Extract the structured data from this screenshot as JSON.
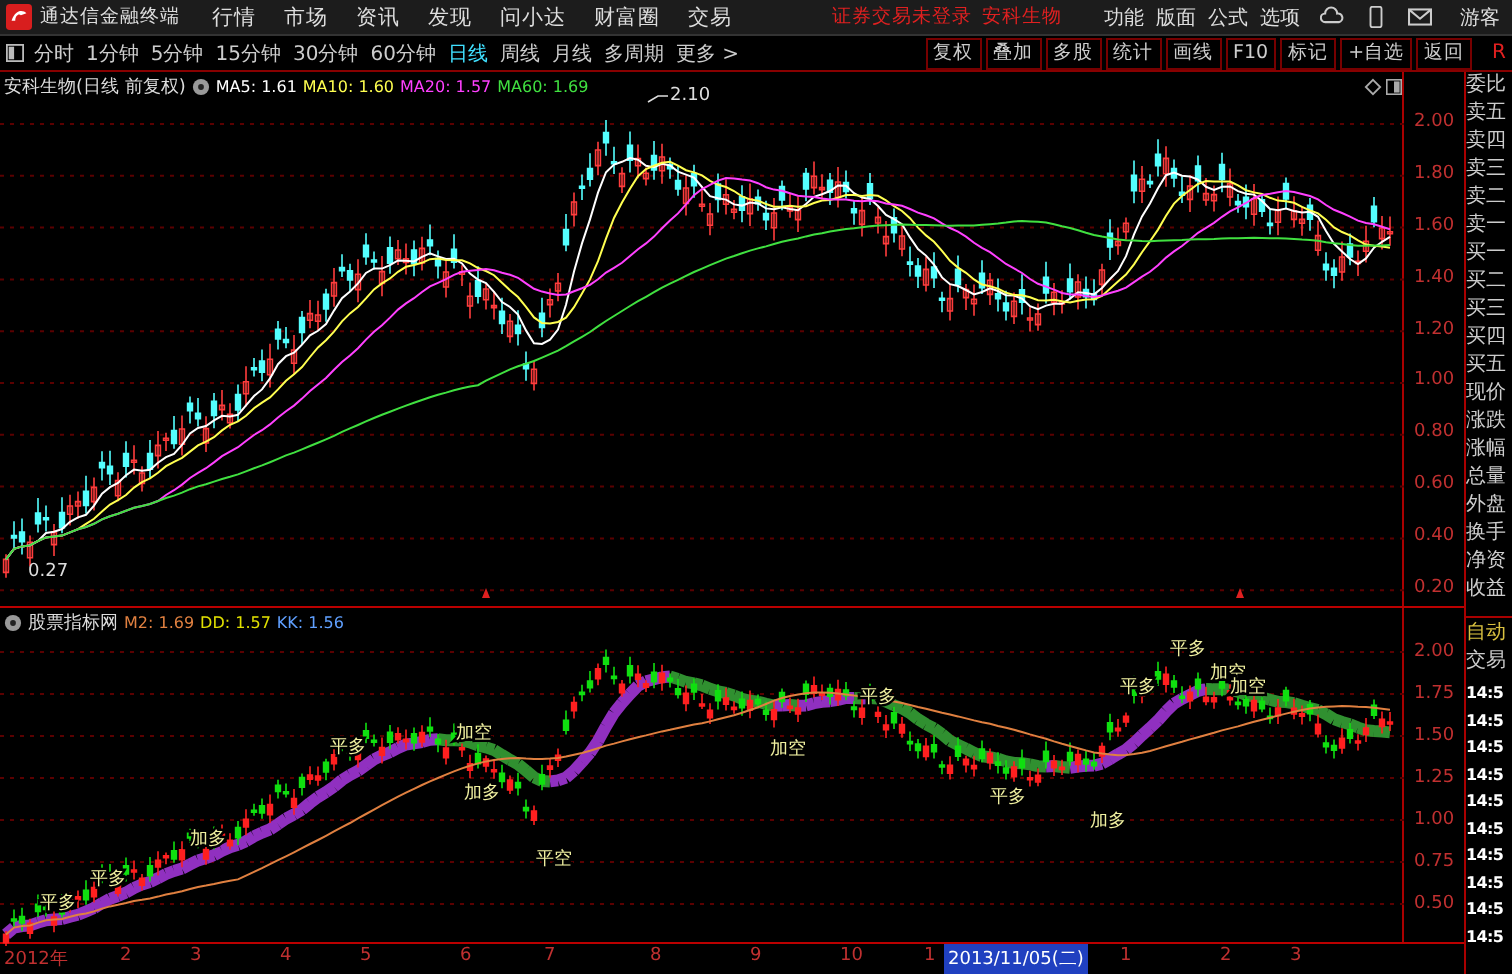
{
  "app": {
    "title": "通达信金融终端"
  },
  "menu": [
    "行情",
    "市场",
    "资讯",
    "发现",
    "问小达",
    "财富圈",
    "交易"
  ],
  "login_status": "证券交易未登录",
  "stock_link": "安科生物",
  "top_actions": [
    "功能",
    "版面",
    "公式",
    "选项"
  ],
  "user": "游客",
  "period_tabs": [
    {
      "label": "分时",
      "selected": false
    },
    {
      "label": "1分钟",
      "selected": false
    },
    {
      "label": "5分钟",
      "selected": false
    },
    {
      "label": "15分钟",
      "selected": false
    },
    {
      "label": "30分钟",
      "selected": false
    },
    {
      "label": "60分钟",
      "selected": false
    },
    {
      "label": "日线",
      "selected": true
    },
    {
      "label": "周线",
      "selected": false
    },
    {
      "label": "月线",
      "selected": false
    },
    {
      "label": "多周期",
      "selected": false
    },
    {
      "label": "更多 >",
      "selected": false
    }
  ],
  "tool_buttons": [
    "复权",
    "叠加",
    "多股",
    "统计",
    "画线",
    "F10",
    "标记",
    "+自选",
    "返回"
  ],
  "corner_label": "R",
  "upper_chart": {
    "title": "安科生物(日线 前复权)",
    "legend": [
      {
        "label": "MA5: 1.61",
        "color": "#ffffff"
      },
      {
        "label": "MA10: 1.60",
        "color": "#ffff50"
      },
      {
        "label": "MA20: 1.57",
        "color": "#ff40ff"
      },
      {
        "label": "MA60: 1.69",
        "color": "#40e040"
      }
    ],
    "high_mark": "2.10",
    "low_mark": "0.27",
    "y_labels": [
      "2.00",
      "1.80",
      "1.60",
      "1.40",
      "1.20",
      "1.00",
      "0.80",
      "0.60",
      "0.40",
      "0.20"
    ]
  },
  "lower_chart": {
    "title": "股票指标网",
    "legend": [
      {
        "label": "M2: 1.69",
        "color": "#e08040"
      },
      {
        "label": "DD: 1.57",
        "color": "#e0e000"
      },
      {
        "label": "KK: 1.56",
        "color": "#60a0ff"
      }
    ],
    "signals": [
      "平多",
      "平多",
      "加多",
      "平多",
      "加空",
      "加多",
      "平空",
      "加空",
      "平多",
      "平多",
      "加多",
      "平多",
      "平多",
      "加空",
      "加空"
    ],
    "y_labels": [
      "2.00",
      "1.75",
      "1.50",
      "1.25",
      "1.00",
      "0.75",
      "0.50"
    ]
  },
  "x_axis": {
    "labels": [
      "2012年",
      "2",
      "3",
      "4",
      "5",
      "6",
      "7",
      "8",
      "9",
      "10",
      "1",
      "1",
      "2",
      "3"
    ],
    "cursor_date": "2013/11/05(二)"
  },
  "quote_panel": {
    "labels": [
      "委比",
      "卖五",
      "卖四",
      "卖三",
      "卖二",
      "卖一",
      "买一",
      "买二",
      "买三",
      "买四",
      "买五",
      "现价",
      "涨跌",
      "涨幅",
      "总量",
      "外盘",
      "换手",
      "净资",
      "收益"
    ],
    "mode": "自动",
    "section": "交易",
    "times": [
      "14:5",
      "14:5",
      "14:5",
      "14:5",
      "14:5",
      "14:5",
      "14:5",
      "14:5",
      "14:5",
      "14:5"
    ]
  }
}
